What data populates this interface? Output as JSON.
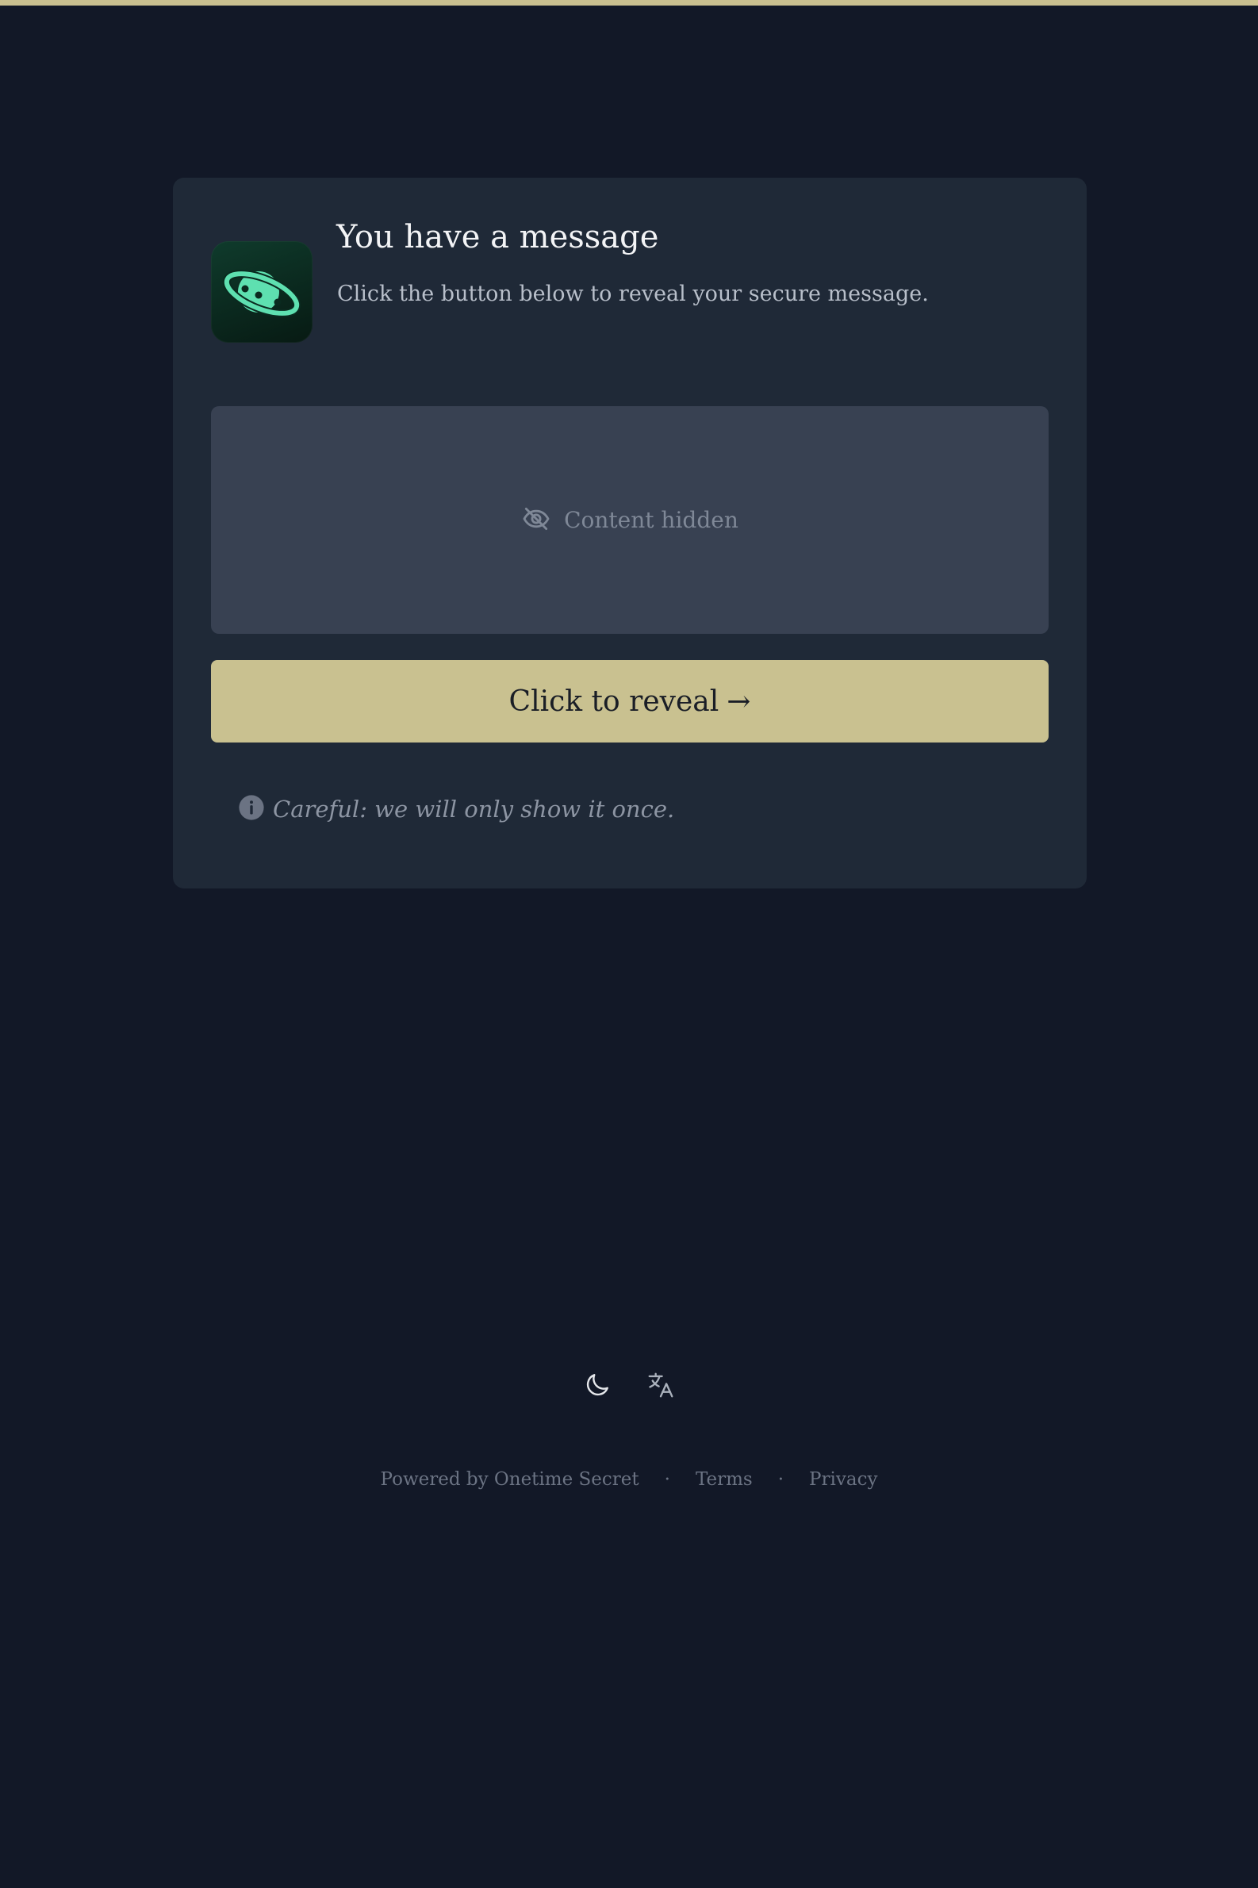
{
  "colors": {
    "background": "#121827",
    "card": "#1f2937",
    "accent": "#c9c190",
    "hidden_box": "#384152",
    "logo_green": "#5ee0b0"
  },
  "header": {
    "title": "You have a message",
    "subtitle": "Click the button below to reveal your secure message."
  },
  "logo": {
    "icon": "planet-icon"
  },
  "secret": {
    "hidden_icon": "eye-slash-icon",
    "hidden_label": "Content hidden"
  },
  "reveal_button": {
    "label": "Click to reveal",
    "arrow": "→"
  },
  "warning": {
    "icon": "info-icon",
    "text": "Careful: we will only show it once."
  },
  "footer": {
    "theme_icon": "moon-icon",
    "language_icon": "translate-icon",
    "powered_by": "Powered by Onetime Secret",
    "separator": "·",
    "terms": "Terms",
    "privacy": "Privacy"
  }
}
